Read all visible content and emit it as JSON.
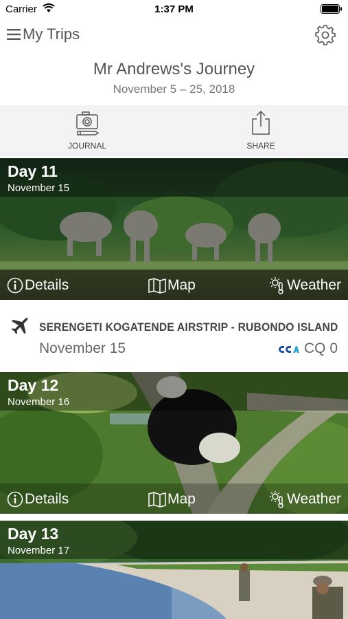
{
  "status_bar": {
    "carrier": "Carrier",
    "time": "1:37 PM"
  },
  "nav": {
    "title": "My Trips"
  },
  "journey": {
    "title": "Mr Andrews's Journey",
    "dates": "November 5 – 25, 2018"
  },
  "actions": [
    {
      "label": "JOURNAL",
      "icon": "camera-pencil-icon"
    },
    {
      "label": "SHARE",
      "icon": "share-icon"
    }
  ],
  "days": [
    {
      "label": "Day 11",
      "date": "November 15",
      "photo": "elephants-by-river"
    },
    {
      "label": "Day 12",
      "date": "November 16",
      "photo": "colobus-monkey-in-tree"
    },
    {
      "label": "Day 13",
      "date": "November 17",
      "photo": "lake-shore-fisherman"
    }
  ],
  "card_buttons": {
    "details": "Details",
    "map": "Map",
    "weather": "Weather"
  },
  "flight": {
    "route": "SERENGETI KOGATENDE AIRSTRIP - RUBONDO ISLAND",
    "date": "November 15",
    "airline_logo": "CCA",
    "cq": "CQ 0"
  },
  "colors": {
    "text": "#555555",
    "action_bar": "#f3f3f3",
    "airline_blue": "#1e4fa3"
  }
}
